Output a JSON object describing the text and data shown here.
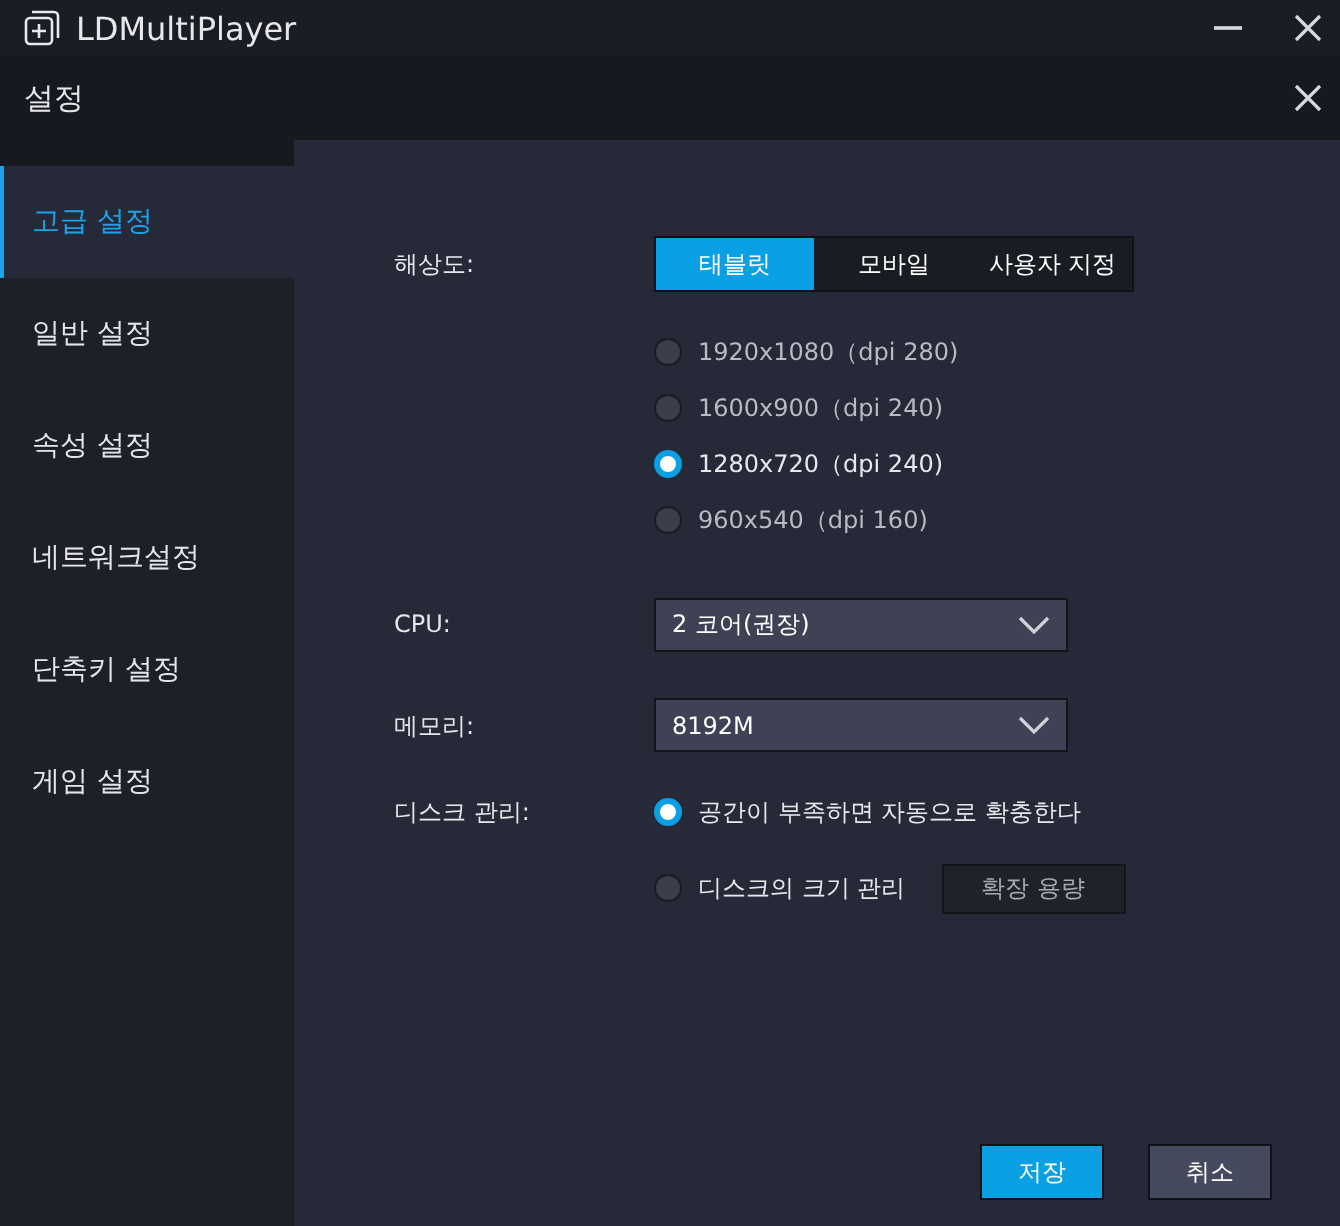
{
  "window": {
    "title": "LDMultiPlayer"
  },
  "dialog": {
    "title": "설정"
  },
  "sidebar": {
    "items": [
      {
        "label": "고급 설정",
        "selected": true
      },
      {
        "label": "일반 설정",
        "selected": false
      },
      {
        "label": "속성 설정",
        "selected": false
      },
      {
        "label": "네트워크설정",
        "selected": false
      },
      {
        "label": "단축키 설정",
        "selected": false
      },
      {
        "label": "게임 설정",
        "selected": false
      }
    ]
  },
  "resolution": {
    "label": "해상도:",
    "tabs": [
      {
        "label": "태블릿",
        "selected": true
      },
      {
        "label": "모바일",
        "selected": false
      },
      {
        "label": "사용자 지정",
        "selected": false
      }
    ],
    "options": [
      {
        "label": "1920x1080（dpi 280)",
        "selected": false
      },
      {
        "label": "1600x900（dpi 240)",
        "selected": false
      },
      {
        "label": "1280x720（dpi 240)",
        "selected": true
      },
      {
        "label": "960x540（dpi 160)",
        "selected": false
      }
    ]
  },
  "cpu": {
    "label": "CPU:",
    "value": "2 코어(권장)"
  },
  "memory": {
    "label": "메모리:",
    "value": "8192M"
  },
  "disk": {
    "label": "디스크 관리:",
    "options": [
      {
        "label": "공간이 부족하면 자동으로 확충한다",
        "selected": true
      },
      {
        "label": "디스크의 크기 관리",
        "selected": false,
        "button": "확장 용량"
      }
    ]
  },
  "buttons": {
    "save": "저장",
    "cancel": "취소"
  }
}
